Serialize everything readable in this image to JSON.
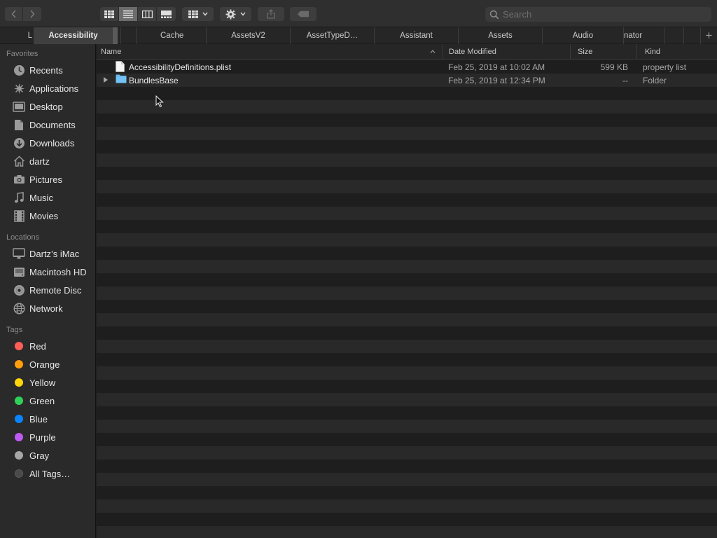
{
  "toolbar": {
    "nav": {
      "back_icon": "chevron-left-icon",
      "forward_icon": "chevron-right-icon"
    },
    "view_modes": [
      "icon-view",
      "list-view",
      "column-view",
      "gallery-view"
    ],
    "active_view": "list-view",
    "group_icon": "group-grid-icon",
    "action_icon": "gear-icon",
    "share_icon": "share-icon",
    "tag_icon": "tag-icon",
    "search": {
      "placeholder": "Search",
      "value": ""
    }
  },
  "tabs": [
    {
      "label": "L"
    },
    {
      "label": "Accessibility",
      "active": true
    },
    {
      "label": ""
    },
    {
      "label": ""
    },
    {
      "label": "Cache"
    },
    {
      "label": "AssetsV2"
    },
    {
      "label": "AssetTypeD…"
    },
    {
      "label": "Assistant"
    },
    {
      "label": "Assets"
    },
    {
      "label": "Audio"
    },
    {
      "label": "nator"
    },
    {
      "label": ""
    },
    {
      "label": ""
    }
  ],
  "sidebar": {
    "favorites_title": "Favorites",
    "favorites": [
      {
        "label": "Recents",
        "icon": "clock-icon"
      },
      {
        "label": "Applications",
        "icon": "applications-icon"
      },
      {
        "label": "Desktop",
        "icon": "desktop-icon"
      },
      {
        "label": "Documents",
        "icon": "document-icon"
      },
      {
        "label": "Downloads",
        "icon": "download-icon"
      },
      {
        "label": "dartz",
        "icon": "home-icon"
      },
      {
        "label": "Pictures",
        "icon": "camera-icon"
      },
      {
        "label": "Music",
        "icon": "music-note-icon"
      },
      {
        "label": "Movies",
        "icon": "film-icon"
      }
    ],
    "locations_title": "Locations",
    "locations": [
      {
        "label": "Dartz’s iMac",
        "icon": "imac-icon"
      },
      {
        "label": "Macintosh HD",
        "icon": "hard-drive-icon"
      },
      {
        "label": "Remote Disc",
        "icon": "disc-icon"
      },
      {
        "label": "Network",
        "icon": "globe-icon"
      }
    ],
    "tags_title": "Tags",
    "tags": [
      {
        "label": "Red",
        "color": "#ff5f57"
      },
      {
        "label": "Orange",
        "color": "#ff9f0a"
      },
      {
        "label": "Yellow",
        "color": "#ffd60a"
      },
      {
        "label": "Green",
        "color": "#30d158"
      },
      {
        "label": "Blue",
        "color": "#0a84ff"
      },
      {
        "label": "Purple",
        "color": "#bf5af2"
      },
      {
        "label": "Gray",
        "color": "#a6a6a6"
      },
      {
        "label": "All Tags…",
        "color": ""
      }
    ]
  },
  "columns": {
    "name": "Name",
    "date": "Date Modified",
    "size": "Size",
    "kind": "Kind"
  },
  "files": [
    {
      "name": "AccessibilityDefinitions.plist",
      "date": "Feb 25, 2019 at 10:02 AM",
      "size": "599 KB",
      "kind": "property list",
      "icon": "plist-file-icon",
      "expandable": false
    },
    {
      "name": "BundlesBase",
      "date": "Feb 25, 2019 at 12:34 PM",
      "size": "--",
      "kind": "Folder",
      "icon": "folder-icon",
      "expandable": true
    }
  ]
}
